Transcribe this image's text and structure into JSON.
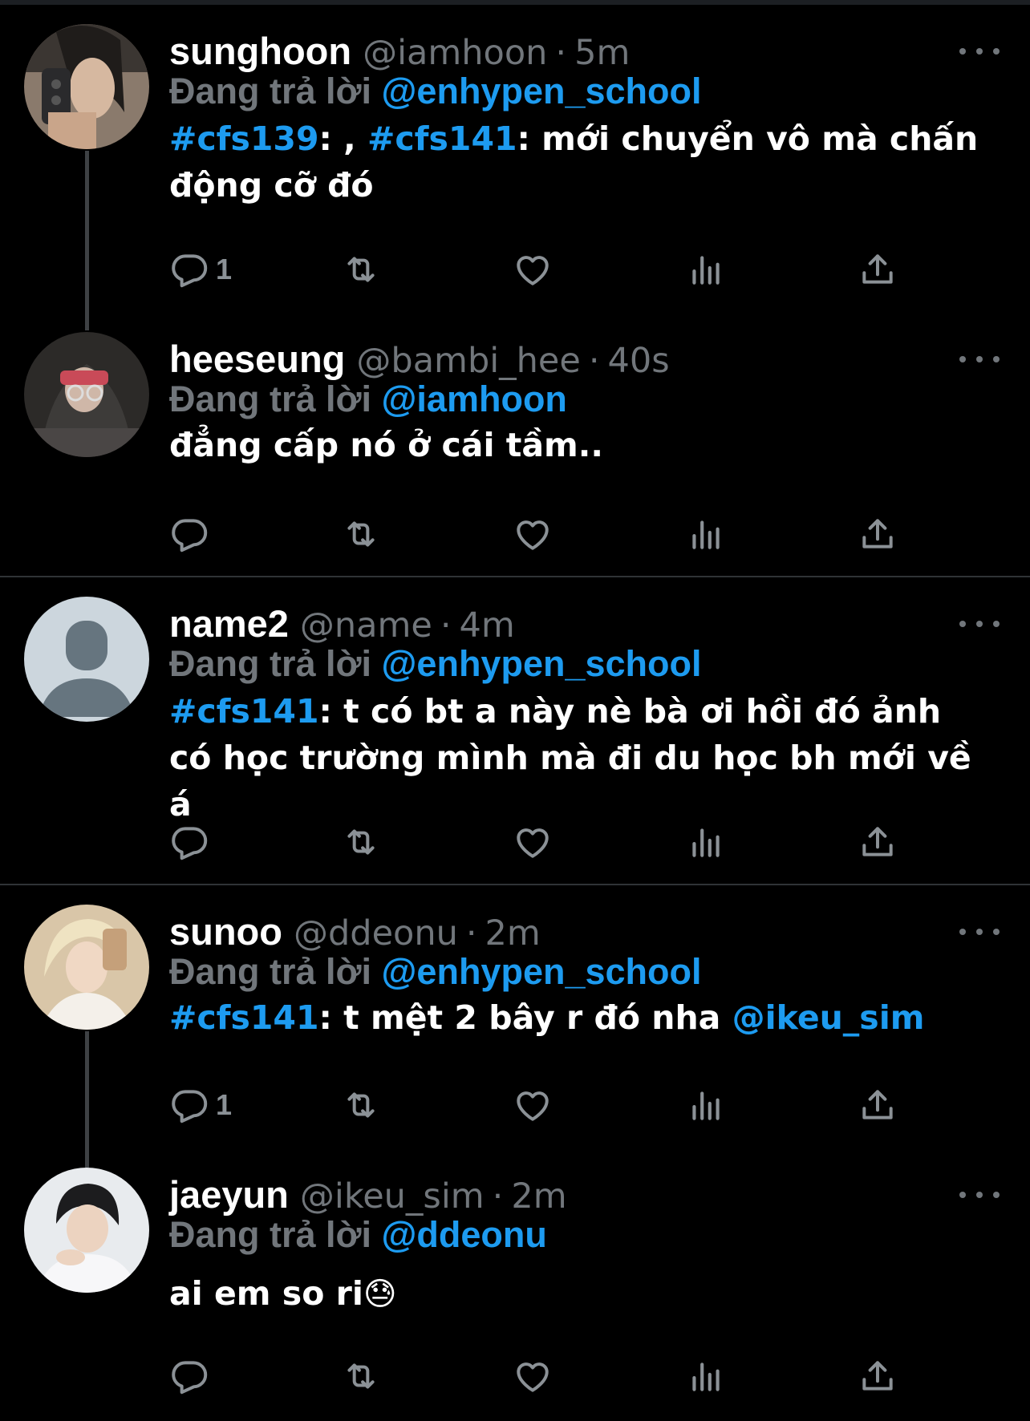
{
  "colors": {
    "background": "#000000",
    "text": "#ffffff",
    "muted": "#71767b",
    "link": "#1d9bf0",
    "divider": "#2f3336"
  },
  "reply_prefix": "Đang trả lời",
  "tweets": [
    {
      "name": "sunghoon",
      "handle": "@iamhoon",
      "sep": "·",
      "time": "5m",
      "reply_to": "@enhypen_school",
      "body": {
        "tag1": "#cfs139",
        "mid1": ": , ",
        "tag2": "#cfs141",
        "text": ": mới chuyển vô mà chấn động cỡ đó"
      },
      "reply_count": "1",
      "avatar": "photo-dark-haired-selfie"
    },
    {
      "name": "heeseung",
      "handle": "@bambi_hee",
      "sep": "·",
      "time": "40s",
      "reply_to": "@iamhoon",
      "body": {
        "text": "đẳng cấp nó ở cái tầm.."
      },
      "reply_count": "",
      "avatar": "photo-hooded-person"
    },
    {
      "name": "name2",
      "handle": "@name",
      "sep": "·",
      "time": "4m",
      "reply_to": "@enhypen_school",
      "body": {
        "tag1": "#cfs141",
        "text": ": t có bt a này nè bà ơi hồi đó ảnh có học trường mình mà đi du học bh mới về á"
      },
      "reply_count": "",
      "avatar": "default-profile-silhouette"
    },
    {
      "name": "sunoo",
      "handle": "@ddeonu",
      "sep": "·",
      "time": "2m",
      "reply_to": "@enhypen_school",
      "body": {
        "tag1": "#cfs141",
        "text": ": t mệt 2 bây r đó nha ",
        "mention": "@ikeu_sim"
      },
      "reply_count": "1",
      "avatar": "photo-blond-mirror-selfie"
    },
    {
      "name": "jaeyun",
      "handle": "@ikeu_sim",
      "sep": "·",
      "time": "2m",
      "reply_to": "@ddeonu",
      "body": {
        "text": "ai em so ri",
        "emoji": "😓"
      },
      "reply_count": "",
      "avatar": "photo-person-white-shirt"
    }
  ],
  "action_icons": [
    "reply-icon",
    "retweet-icon",
    "like-icon",
    "views-icon",
    "share-icon"
  ]
}
